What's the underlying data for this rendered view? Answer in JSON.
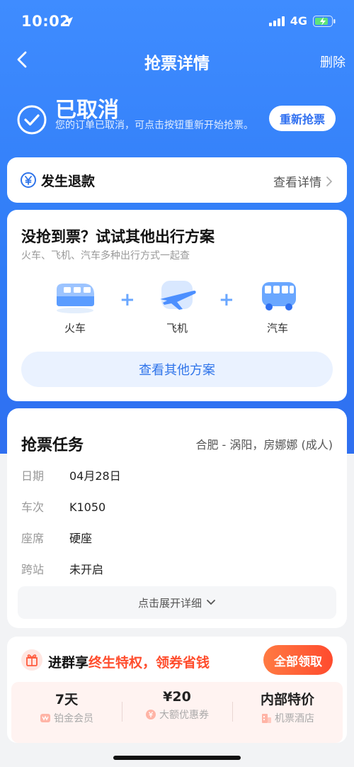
{
  "status_bar": {
    "time": "10:02",
    "network": "4G"
  },
  "nav": {
    "title": "抢票详情",
    "delete_label": "删除"
  },
  "order_status": {
    "title": "已取消",
    "description": "您的订单已取消，可点击按钮重新开始抢票。",
    "regrab_label": "重新抢票"
  },
  "refund": {
    "title": "发生退款",
    "detail_label": "查看详情"
  },
  "alternatives": {
    "title": "没抢到票？试试其他出行方案",
    "subtitle": "火车、飞机、汽车多种出行方式一起查",
    "modes": [
      {
        "label": "火车",
        "icon": "train-icon"
      },
      {
        "label": "飞机",
        "icon": "airplane-icon"
      },
      {
        "label": "汽车",
        "icon": "bus-icon"
      }
    ],
    "plus_symbol": "+",
    "button_label": "查看其他方案"
  },
  "task": {
    "title": "抢票任务",
    "route": "合肥 - 涡阳，房娜娜 (成人)",
    "rows": [
      {
        "key": "日期",
        "value": "04月28日"
      },
      {
        "key": "车次",
        "value": "K1050"
      },
      {
        "key": "座席",
        "value": "硬座"
      },
      {
        "key": "跨站",
        "value": "未开启"
      }
    ],
    "expand_label": "点击展开详细"
  },
  "group_promo": {
    "prefix": "进群享",
    "highlight": "终生特权，领券省钱",
    "claim_label": "全部领取",
    "perks": [
      {
        "main": "7天",
        "sub": "铂金会员",
        "icon": "vip-icon"
      },
      {
        "main": "¥20",
        "sub": "大额优惠券",
        "icon": "coupon-icon"
      },
      {
        "main": "内部特价",
        "sub": "机票酒店",
        "icon": "hotel-icon"
      }
    ]
  },
  "colors": {
    "primary_blue": "#2f6ff0",
    "promo_orange": "#ff4b2e",
    "highlight_red": "#ff4d2d"
  }
}
